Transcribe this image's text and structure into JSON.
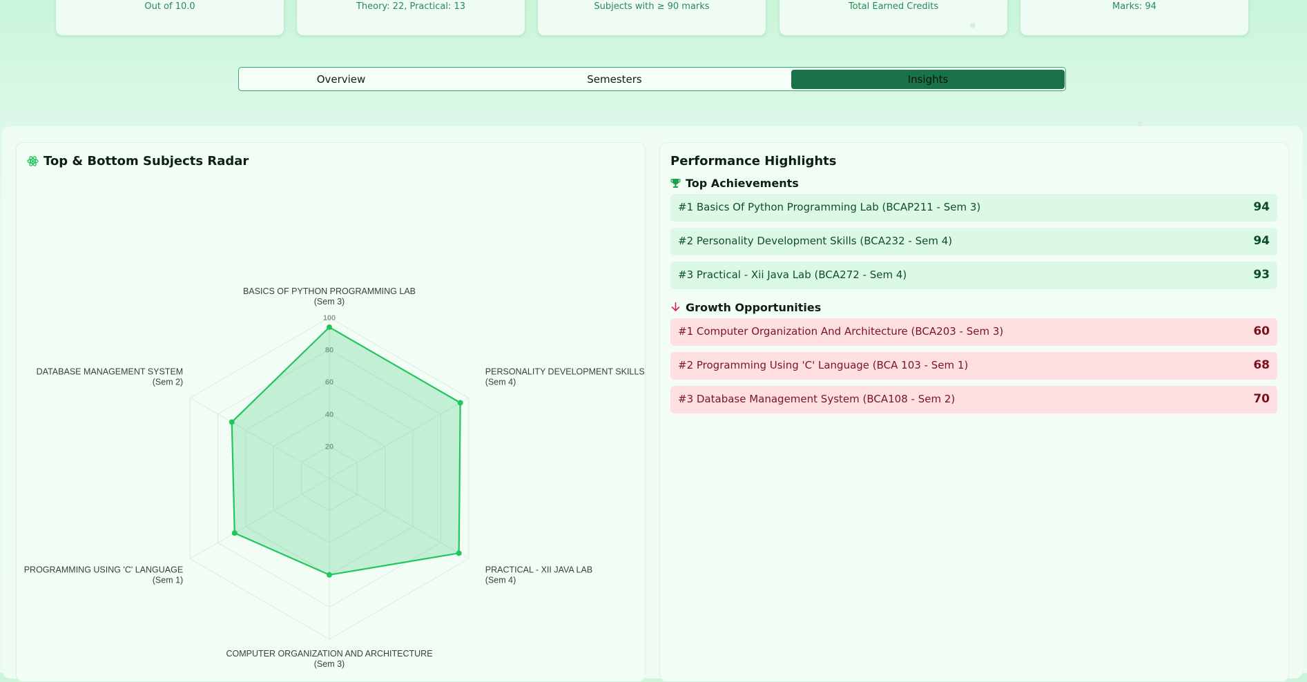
{
  "stats": [
    {
      "sub": "Out of 10.0"
    },
    {
      "sub": "Theory: 22, Practical: 13"
    },
    {
      "sub": "Subjects with ≥ 90 marks"
    },
    {
      "sub": "Total Earned Credits"
    },
    {
      "sub": "Marks: 94"
    }
  ],
  "tabs": [
    {
      "label": "Overview",
      "active": false
    },
    {
      "label": "Semesters",
      "active": false
    },
    {
      "label": "Insights",
      "active": true
    }
  ],
  "radar": {
    "title": "Top & Bottom Subjects Radar",
    "icon": "atom-icon",
    "accent": "#22c55e",
    "scale_max": 100,
    "ticks": [
      "20",
      "40",
      "60",
      "80",
      "100"
    ],
    "axes": [
      {
        "name": "BASICS OF PYTHON PROGRAMMING LAB",
        "sem": "(Sem 3)",
        "value": 94
      },
      {
        "name": "PERSONALITY DEVELOPMENT SKILLS",
        "sem": "(Sem 4)",
        "value": 94
      },
      {
        "name": "PRACTICAL - XII JAVA LAB",
        "sem": "(Sem 4)",
        "value": 93
      },
      {
        "name": "COMPUTER ORGANIZATION AND ARCHITECTURE",
        "sem": "(Sem 3)",
        "value": 60
      },
      {
        "name": "PROGRAMMING USING 'C' LANGUAGE",
        "sem": "(Sem 1)",
        "value": 68
      },
      {
        "name": "DATABASE MANAGEMENT SYSTEM",
        "sem": "(Sem 2)",
        "value": 70
      }
    ]
  },
  "highlights": {
    "title": "Performance Highlights",
    "top_title": "Top Achievements",
    "top_icon": "trophy-icon",
    "top": [
      {
        "label": "#1 Basics Of Python Programming Lab (BCAP211 - Sem 3)",
        "value": "94"
      },
      {
        "label": "#2 Personality Development Skills (BCA232 - Sem 4)",
        "value": "94"
      },
      {
        "label": "#3 Practical - Xii Java Lab (BCA272 - Sem 4)",
        "value": "93"
      }
    ],
    "growth_title": "Growth Opportunities",
    "growth_icon": "arrow-down-icon",
    "growth": [
      {
        "label": "#1 Computer Organization And Architecture (BCA203 - Sem 3)",
        "value": "60"
      },
      {
        "label": "#2 Programming Using 'C' Language (BCA 103 - Sem 1)",
        "value": "68"
      },
      {
        "label": "#3 Database Management System (BCA108 - Sem 2)",
        "value": "70"
      }
    ]
  }
}
